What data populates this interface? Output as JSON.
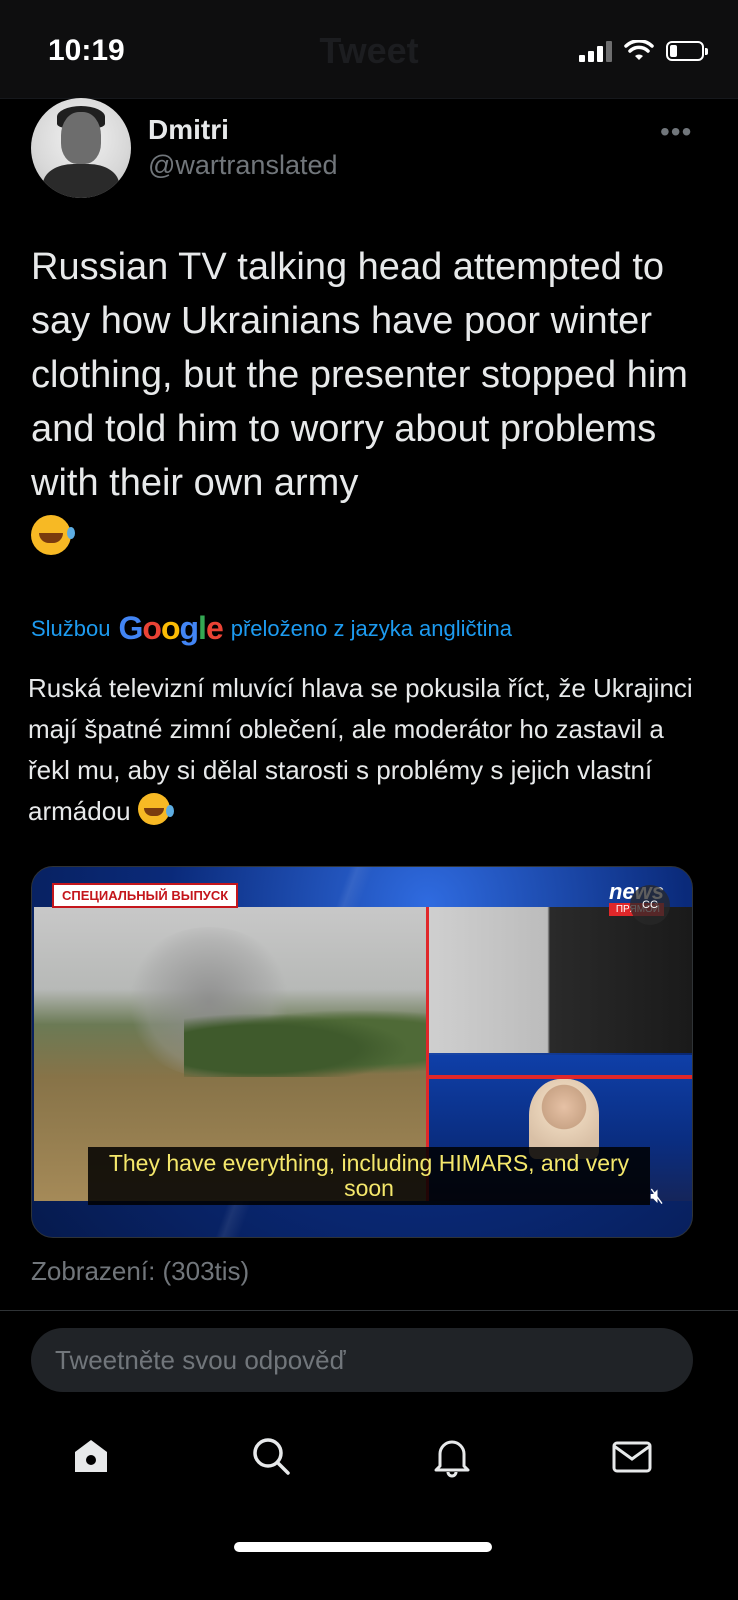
{
  "status_bar": {
    "time": "10:19",
    "ghost_title": "Tweet"
  },
  "tweet": {
    "author_name": "Dmitri",
    "author_handle": "@wartranslated",
    "more_icon": "more-horizontal-icon",
    "text": "Russian TV talking head attempted to say how Ukrainians have poor winter clothing, but the presenter stopped him and told him to worry about problems with their own army",
    "emoji": "rolling-on-floor-laughing-emoji",
    "translation_prefix": "Službou",
    "translation_brand": "Google",
    "translation_suffix": "přeloženo z jazyka angličtina",
    "translated_text": "Ruská televizní mluvící hlava se pokusila říct, že Ukrajinci mají špatné zimní oblečení, ale moderátor ho zastavil a řekl mu, aby si dělal starosti s problémy s jejich vlastní armádou",
    "views": "Zobrazení: (303tis)"
  },
  "video": {
    "tag": "СПЕЦИАЛЬНЫЙ ВЫПУСК",
    "channel": "news",
    "live_label": "ПРЯМОЙ",
    "cc_label": "CC",
    "caption": "They have everything, including HIMARS, and very soon",
    "mute_icon": "speaker-muted-icon"
  },
  "reply": {
    "placeholder": "Tweetněte svou odpověď"
  },
  "tabs": [
    {
      "name": "home",
      "icon": "home-icon"
    },
    {
      "name": "search",
      "icon": "search-icon"
    },
    {
      "name": "notifications",
      "icon": "bell-icon"
    },
    {
      "name": "messages",
      "icon": "mail-icon"
    }
  ],
  "colors": {
    "background": "#000000",
    "accent": "#1d9bf0",
    "text": "#e7e9ea",
    "secondary": "#71767b",
    "caption": "#f4e76b"
  }
}
